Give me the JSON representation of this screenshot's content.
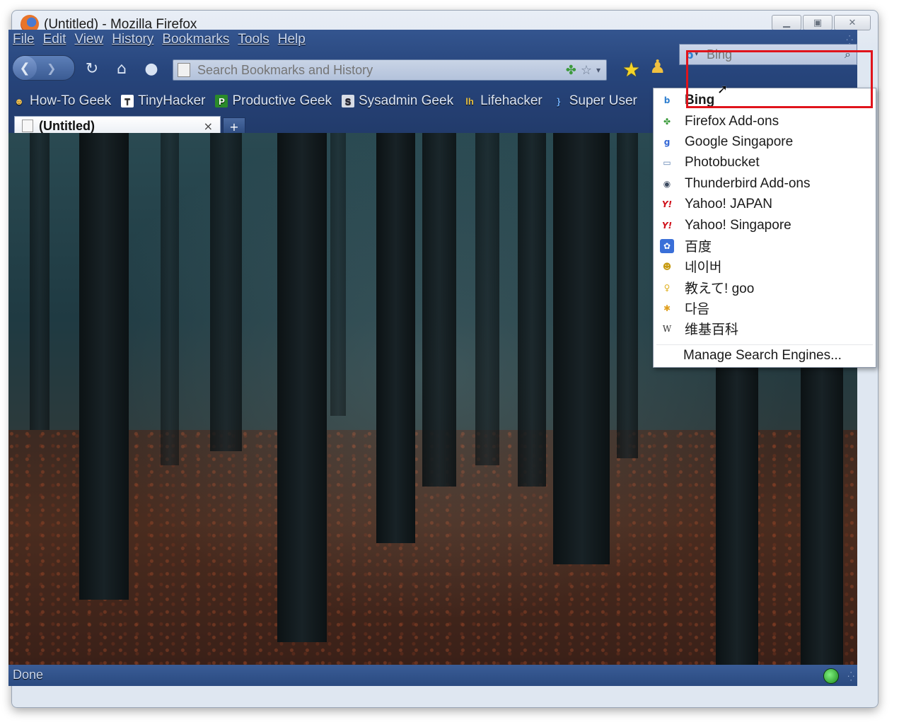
{
  "window": {
    "title": "(Untitled) - Mozilla Firefox",
    "controls": [
      "minimize",
      "maximize",
      "close"
    ]
  },
  "menu": {
    "items": [
      "File",
      "Edit",
      "View",
      "History",
      "Bookmarks",
      "Tools",
      "Help"
    ]
  },
  "navbar": {
    "url_placeholder": "Search Bookmarks and History"
  },
  "search": {
    "engine": "Bing",
    "placeholder": "Bing"
  },
  "bookmarks": [
    {
      "label": "How-To Geek",
      "icon": "howtogeek-icon"
    },
    {
      "label": "TinyHacker",
      "icon": "tinyhacker-icon"
    },
    {
      "label": "Productive Geek",
      "icon": "productivegeek-icon"
    },
    {
      "label": "Sysadmin Geek",
      "icon": "sysadmingeek-icon"
    },
    {
      "label": "Lifehacker",
      "icon": "lifehacker-icon"
    },
    {
      "label": "Super User",
      "icon": "superuser-icon"
    }
  ],
  "tabs": [
    {
      "title": "(Untitled)",
      "close": "×"
    }
  ],
  "newtab_label": "+",
  "search_engines": [
    {
      "label": "Bing",
      "icon": "bing-icon",
      "selected": true
    },
    {
      "label": "Firefox Add-ons",
      "icon": "firefox-addons-icon"
    },
    {
      "label": "Google Singapore",
      "icon": "google-icon"
    },
    {
      "label": "Photobucket",
      "icon": "photobucket-icon"
    },
    {
      "label": "Thunderbird Add-ons",
      "icon": "thunderbird-icon"
    },
    {
      "label": "Yahoo! JAPAN",
      "icon": "yahoo-icon"
    },
    {
      "label": "Yahoo! Singapore",
      "icon": "yahoo-icon"
    },
    {
      "label": "百度",
      "icon": "baidu-icon"
    },
    {
      "label": "네이버",
      "icon": "naver-icon"
    },
    {
      "label": "教えて! goo",
      "icon": "goo-icon"
    },
    {
      "label": "다음",
      "icon": "daum-icon"
    },
    {
      "label": "维基百科",
      "icon": "wikipedia-icon"
    }
  ],
  "manage_engines": "Manage Search Engines...",
  "status": {
    "text": "Done"
  },
  "colors": {
    "chrome_blue": "#27457c",
    "highlight_red": "#e0141c"
  }
}
